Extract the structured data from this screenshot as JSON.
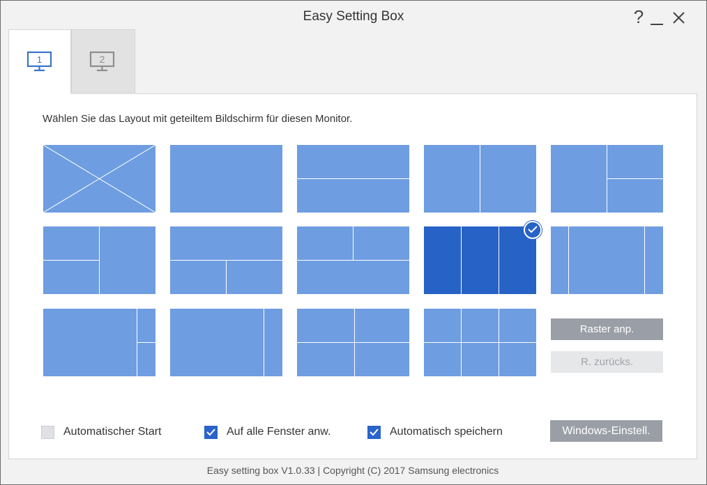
{
  "window": {
    "title": "Easy Setting Box",
    "help_label": "?"
  },
  "tabs": [
    {
      "label": "1",
      "active": true
    },
    {
      "label": "2",
      "active": false
    }
  ],
  "main": {
    "instruction": "Wählen Sie das Layout mit geteiltem Bildschirm für diesen Monitor.",
    "selected_layout": 9,
    "raster_button": "Raster anp.",
    "reset_button": "R. zurücks."
  },
  "options": {
    "auto_start": {
      "label": "Automatischer Start",
      "checked": false
    },
    "apply_all": {
      "label": "Auf alle Fenster anw.",
      "checked": true
    },
    "auto_save": {
      "label": "Automatisch speichern",
      "checked": true
    },
    "windows_button": "Windows-Einstell."
  },
  "footer": "Easy setting box V1.0.33 | Copyright (C) 2017 Samsung electronics",
  "colors": {
    "tile": "#6e9de1",
    "tile_selected": "#2762c6",
    "checkbox": "#2a63c9",
    "button": "#9a9ea6"
  }
}
